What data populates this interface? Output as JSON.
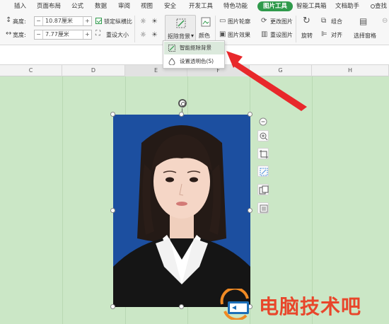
{
  "menu": {
    "tabs": [
      "插入",
      "页面布局",
      "公式",
      "数据",
      "审阅",
      "视图",
      "安全",
      "开发工具",
      "特色功能",
      "图片工具",
      "智能工具箱",
      "文档助手",
      "查找"
    ],
    "active_tab": "图片工具"
  },
  "ribbon": {
    "height_label": "高度:",
    "height_value": "10.87厘米",
    "width_label": "宽度:",
    "width_value": "7.77厘米",
    "lock_ratio": "锁定纵横比",
    "reset_size": "重设大小",
    "remove_bg": "抠除背景",
    "color": "颜色",
    "picture_outline": "图片轮廓",
    "picture_effects": "图片效果",
    "change_picture": "更改图片",
    "reset_picture": "重设图片",
    "rotate": "旋转",
    "group": "组合",
    "align": "对齐",
    "selection_pane": "选择窗格"
  },
  "dropdown": {
    "items": [
      "智能抠除背景",
      "设置透明色(S)"
    ],
    "highlighted": "智能抠除背景"
  },
  "sheet": {
    "columns": [
      "C",
      "D",
      "E",
      "F",
      "G",
      "H"
    ],
    "selected_columns": [
      "E",
      "F"
    ]
  },
  "side_tools": [
    "zoom-out",
    "zoom-in",
    "crop",
    "remove-background",
    "convert-picture",
    "picture-print"
  ],
  "watermark": {
    "text": "电脑技术吧"
  },
  "colors": {
    "accent": "#2f9a4b",
    "sheet_background": "#cbe7c6",
    "photo_background": "#1c4fa0",
    "arrow": "#e8282b",
    "watermark": "#e8462b"
  }
}
